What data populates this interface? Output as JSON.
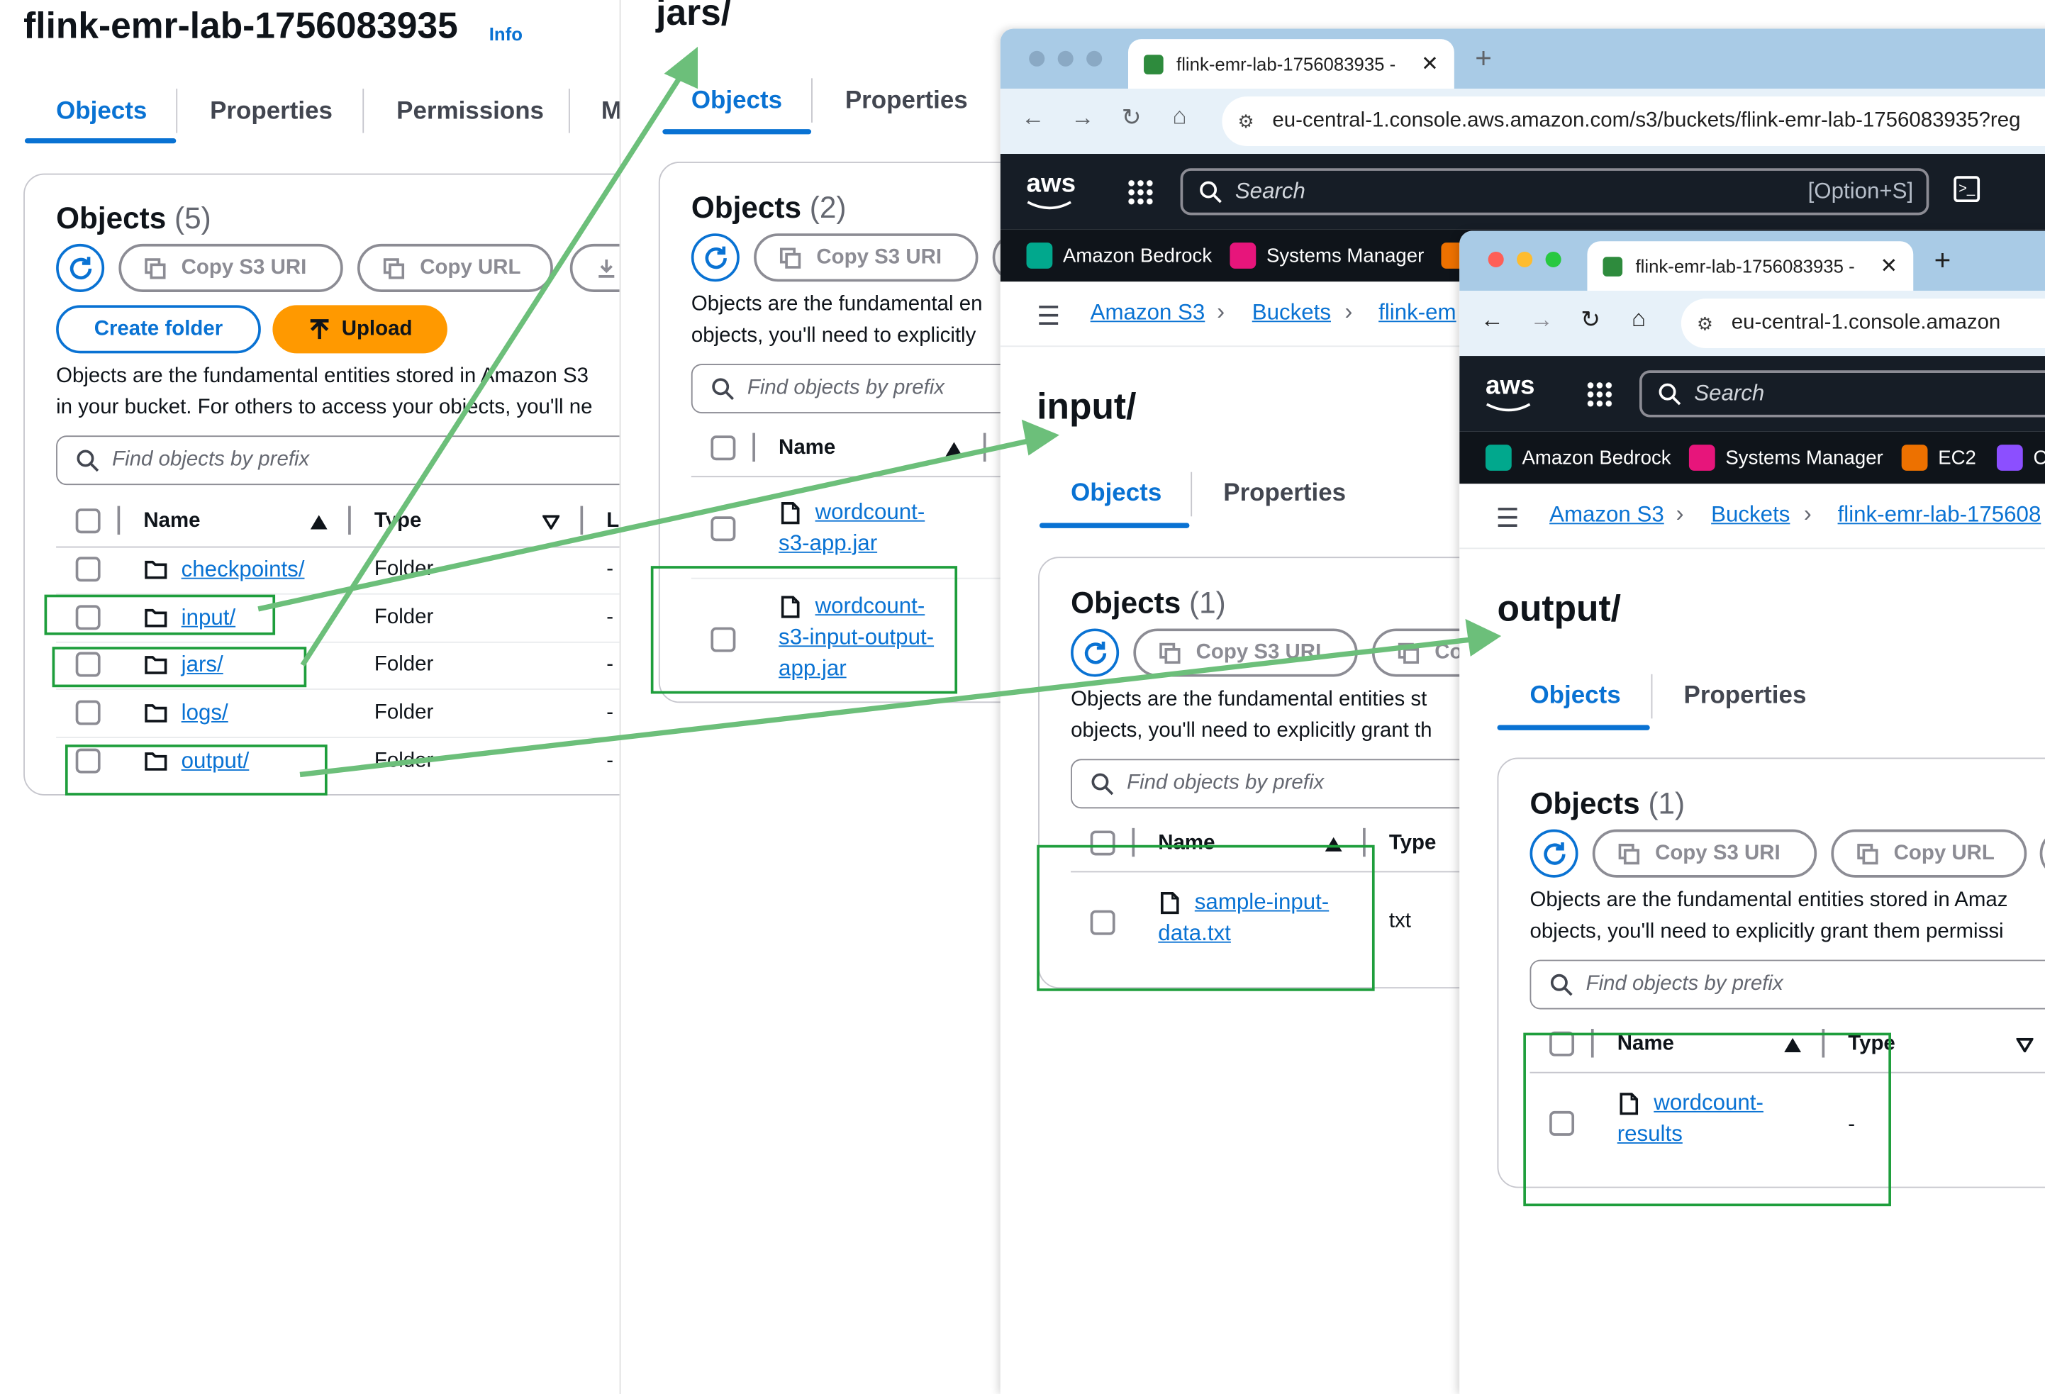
{
  "panel1": {
    "title": "flink-emr-lab-1756083935",
    "info": "Info",
    "tabs": [
      "Objects",
      "Properties",
      "Permissions",
      "M"
    ],
    "card_title": "Objects",
    "card_count": "(5)",
    "copy_s3_uri": "Copy S3 URI",
    "copy_url": "Copy URL",
    "create_folder": "Create folder",
    "upload": "Upload",
    "desc_line1": "Objects are the fundamental entities stored in Amazon S3",
    "desc_line2": "in your bucket. For others to access your objects, you'll ne",
    "search_placeholder": "Find objects by prefix",
    "col_name": "Name",
    "col_type": "Type",
    "col_l": "L",
    "rows": [
      {
        "name": "checkpoints/",
        "type": "Folder",
        "last": "-"
      },
      {
        "name": "input/",
        "type": "Folder",
        "last": "-"
      },
      {
        "name": "jars/",
        "type": "Folder",
        "last": "-"
      },
      {
        "name": "logs/",
        "type": "Folder",
        "last": "-"
      },
      {
        "name": "output/",
        "type": "Folder",
        "last": "-"
      }
    ]
  },
  "panel2": {
    "title": "jars/",
    "tabs": [
      "Objects",
      "Properties"
    ],
    "card_title": "Objects",
    "card_count": "(2)",
    "copy_s3_uri": "Copy S3 URI",
    "desc_line1": "Objects are the fundamental en",
    "desc_line2": "objects, you'll need to explicitly",
    "search_placeholder": "Find objects by prefix",
    "col_name": "Name",
    "rows": [
      {
        "lines": [
          "wordcount-",
          "s3-app.jar"
        ]
      },
      {
        "lines": [
          "wordcount-",
          "s3-input-output-",
          "app.jar"
        ]
      }
    ]
  },
  "browser1": {
    "tab_title": "flink-emr-lab-1756083935 - ",
    "url": "eu-central-1.console.aws.amazon.com/s3/buckets/flink-emr-lab-1756083935?reg",
    "aws": "aws",
    "search": "Search",
    "shortcut": "[Option+S]",
    "favorites": [
      "Amazon Bedrock",
      "Systems Manager"
    ],
    "crumbs": [
      "Amazon S3",
      "Buckets",
      "flink-em"
    ],
    "title": "input/",
    "tabs": [
      "Objects",
      "Properties"
    ],
    "card_title": "Objects",
    "card_count": "(1)",
    "copy_s3_uri": "Copy S3 URI",
    "copy_url": "Co",
    "desc_line1": "Objects are the fundamental entities st",
    "desc_line2": "objects, you'll need to explicitly grant th",
    "search_placeholder": "Find objects by prefix",
    "col_name": "Name",
    "col_type": "Type",
    "row": {
      "lines": [
        "sample-input-",
        "data.txt"
      ],
      "type": "txt"
    }
  },
  "browser2": {
    "tab_title": "flink-emr-lab-1756083935 - ",
    "url": "eu-central-1.console.amazon",
    "aws": "aws",
    "search": "Search",
    "favorites": [
      "Amazon Bedrock",
      "Systems Manager",
      "EC2",
      "C"
    ],
    "crumbs": [
      "Amazon S3",
      "Buckets",
      "flink-emr-lab-175608"
    ],
    "title": "output/",
    "tabs": [
      "Objects",
      "Properties"
    ],
    "card_title": "Objects",
    "card_count": "(1)",
    "copy_s3_uri": "Copy S3 URI",
    "copy_url": "Copy URL",
    "desc_line1": "Objects are the fundamental entities stored in Amaz",
    "desc_line2": "objects, you'll need to explicitly grant them permissi",
    "search_placeholder": "Find objects by prefix",
    "col_name": "Name",
    "col_type": "Type",
    "row": {
      "lines": [
        "wordcount-",
        "results"
      ],
      "type": "-"
    }
  },
  "colors": {
    "link": "#0972d3",
    "upload": "#ff9900",
    "annotation": "#1e9e3c",
    "arrow": "#6cbf7a"
  }
}
